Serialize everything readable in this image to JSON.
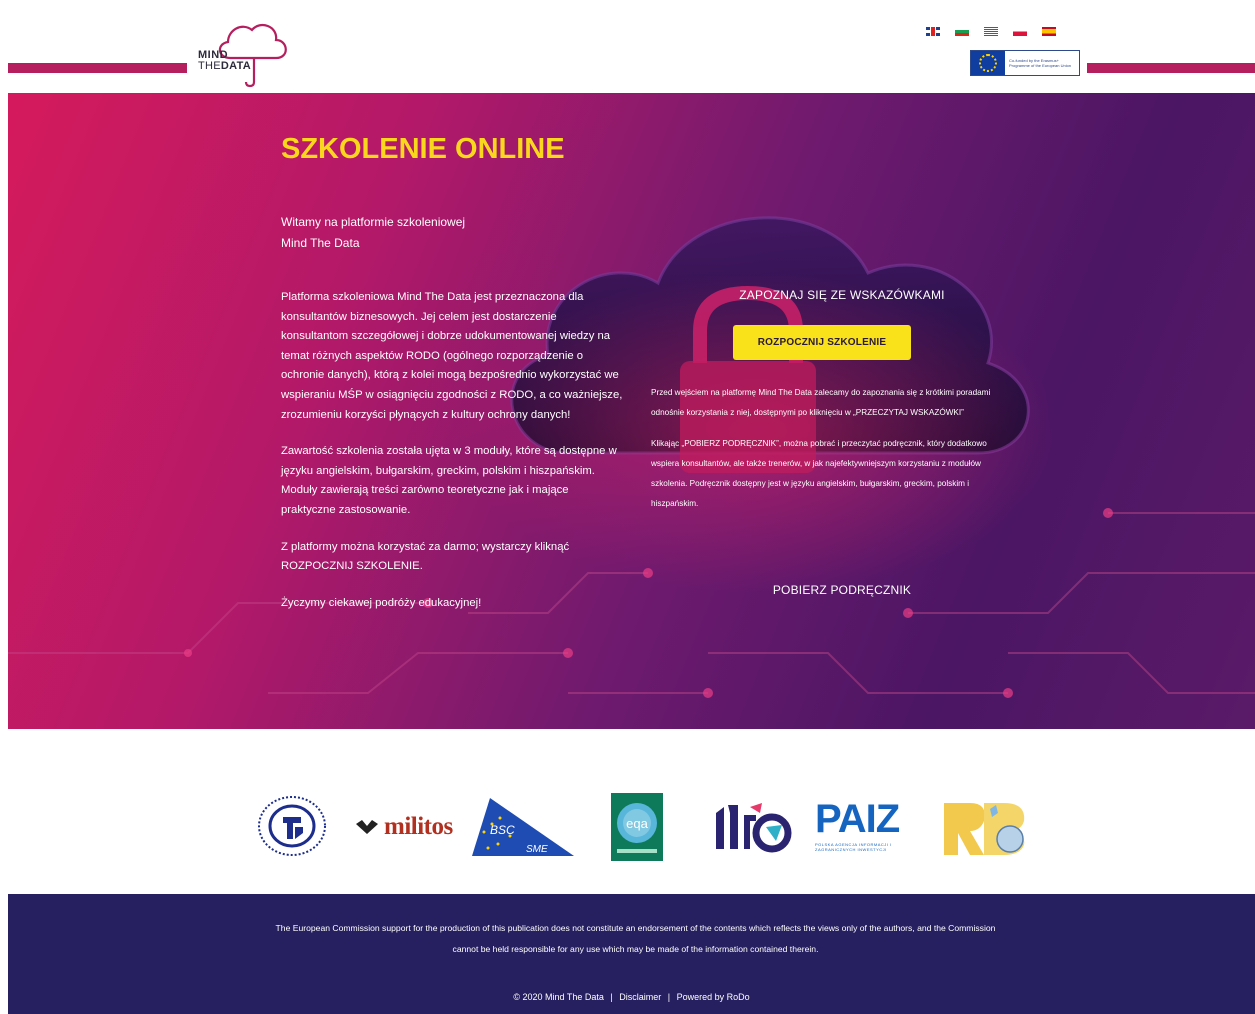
{
  "header": {
    "logo": {
      "line1": "MIND",
      "line2_light": "THE",
      "line2_bold": "DATA"
    },
    "languages": [
      {
        "code": "en",
        "icon": "flag-gb-icon"
      },
      {
        "code": "bg",
        "icon": "flag-bg-icon"
      },
      {
        "code": "el",
        "icon": "flag-gr-icon"
      },
      {
        "code": "pl",
        "icon": "flag-pl-icon"
      },
      {
        "code": "es",
        "icon": "flag-es-icon"
      }
    ],
    "eu_badge": {
      "text": "Co-funded by the Erasmus+ Programme of the European Union"
    },
    "accent_color": "#b51f5e"
  },
  "hero": {
    "title": "SZKOLENIE ONLINE",
    "welcome_line1": "Witamy na platformie szkoleniowej",
    "welcome_line2": "Mind The Data",
    "paragraphs": [
      "Platforma szkoleniowa Mind The Data jest przeznaczona dla konsultantów biznesowych. Jej celem jest dostarczenie konsultantom szczegółowej i dobrze udokumentowanej wiedzy na temat różnych aspektów RODO (ogólnego rozporządzenie o ochronie danych), którą z kolei mogą bezpośrednio wykorzystać we wspieraniu MŚP w osiągnięciu zgodności z RODO, a co ważniejsze, zrozumieniu korzyści płynących z kultury ochrony danych!",
      "Zawartość szkolenia została ujęta w 3 moduły, które są dostępne w języku angielskim, bułgarskim, greckim, polskim i hiszpańskim. Moduły zawierają treści zarówno teoretyczne jak i mające praktyczne  zastosowanie.",
      "Z platformy można korzystać za darmo; wystarczy kliknąć ROZPOCZNIJ SZKOLENIE.",
      "Życzymy ciekawej podróży edukacyjnej!"
    ],
    "guidelines_link": "ZAPOZNAJ SIĘ ZE WSKAZÓWKAMI",
    "start_button": "ROZPOCZNIJ SZKOLENIE",
    "guidelines_text": [
      "Przed wejściem na platformę Mind The Data zalecamy do zapoznania się z krótkimi poradami odnośnie korzystania z niej, dostępnymi po kliknięciu w „PRZECZYTAJ WSKAZÓWKI”",
      "Klikając „POBIERZ PODRĘCZNIK”, można pobrać i przeczytać podręcznik, który dodatkowo wspiera konsultantów, ale także trenerów, w jak najefektywniejszym korzystaniu z modułów szkolenia. Podręcznik dostępny jest w języku angielskim, bułgarskim, greckim, polskim i hiszpańskim."
    ],
    "download_link": "POBIERZ PODRĘCZNIK",
    "colors": {
      "title": "#f9d71c",
      "button": "#f9e21a"
    }
  },
  "partners": [
    {
      "name": "Circle seal partner",
      "icon": "partner-seal-logo"
    },
    {
      "name": "militos",
      "icon": "militos-logo"
    },
    {
      "name": "BSC SME",
      "icon": "bsc-sme-logo"
    },
    {
      "name": "eqa",
      "icon": "eqa-logo"
    },
    {
      "name": "ITCA",
      "icon": "itca-logo"
    },
    {
      "name": "PAIZ",
      "sub": "POLSKA AGENCJA INFORMACJI I ZAGRANICZNYCH INWESTYCJI",
      "icon": "paiz-logo"
    },
    {
      "name": "RoDo",
      "icon": "rodo-logo"
    }
  ],
  "footer": {
    "disclaimer": "The European Commission support for the production of this publication does not constitute an endorsement of the contents which reflects the views only of the authors, and the Commission cannot be held responsible for any use which may be made of the information contained therein.",
    "copyright": "© 2020 Mind The Data",
    "separator": "|",
    "disclaimer_link": "Disclaimer",
    "powered_by": "Powered by RoDo",
    "background": "#262060"
  }
}
